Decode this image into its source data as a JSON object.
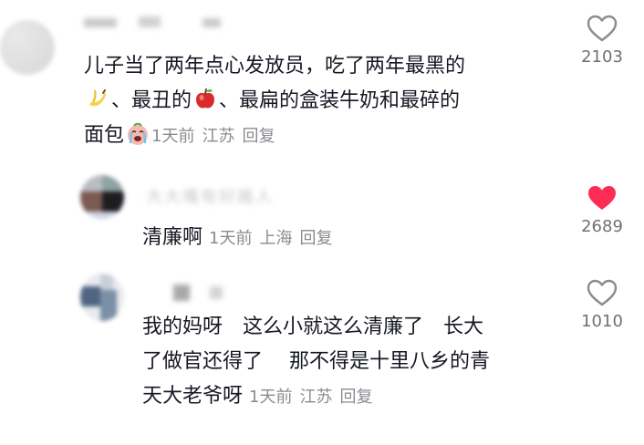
{
  "comments": [
    {
      "line1": "儿子当了两年点心发放员，吃了两年最黑的",
      "line2a": "、最丑的",
      "line2b": "、最扁的盒装牛奶和最碎的",
      "line3": "面包",
      "time": "1天前",
      "location": "江苏",
      "reply": "回复",
      "likes": "2103",
      "liked": false,
      "emojis": [
        "banana-emoji",
        "apple-emoji",
        "crying-face-emoji"
      ]
    },
    {
      "username_blurred": "大大嘴有好路人",
      "text": "清廉啊",
      "time": "1天前",
      "location": "上海",
      "reply": "回复",
      "likes": "2689",
      "liked": true
    },
    {
      "line1": "我的妈呀　这么小就这么清廉了　长大",
      "line2": "了做官还得了　 那不得是十里八乡的青",
      "line3": "天大老爷呀",
      "time": "1天前",
      "location": "江苏",
      "reply": "回复",
      "likes": "1010",
      "liked": false
    }
  ],
  "colors": {
    "text": "#161823",
    "meta": "#8a8b91",
    "like_active": "#fe2c55",
    "like_outline": "#8a8b91"
  }
}
